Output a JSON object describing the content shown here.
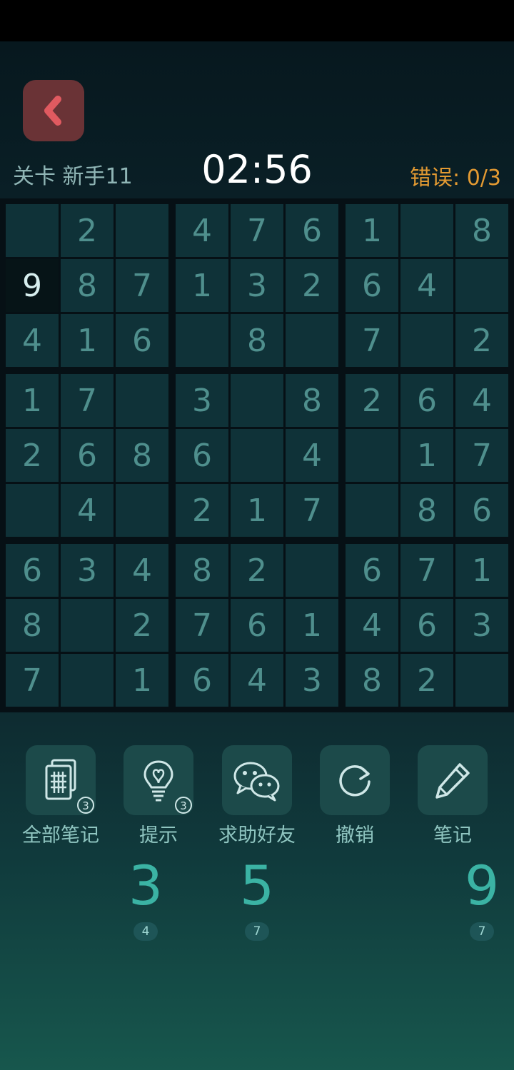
{
  "header": {
    "level": "关卡 新手11",
    "timer": "02:56",
    "errors": "错误: 0/3"
  },
  "board": {
    "selected": [
      1,
      0
    ],
    "grid": [
      [
        "",
        "2",
        "",
        "4",
        "7",
        "6",
        "1",
        "",
        "8"
      ],
      [
        "9",
        "8",
        "7",
        "1",
        "3",
        "2",
        "6",
        "4",
        ""
      ],
      [
        "4",
        "1",
        "6",
        "",
        "8",
        "",
        "7",
        "",
        "2"
      ],
      [
        "1",
        "7",
        "",
        "3",
        "",
        "8",
        "2",
        "6",
        "4"
      ],
      [
        "2",
        "6",
        "8",
        "6",
        "",
        "4",
        "",
        "1",
        "7"
      ],
      [
        "",
        "4",
        "",
        "2",
        "1",
        "7",
        "",
        "8",
        "6"
      ],
      [
        "6",
        "3",
        "4",
        "8",
        "2",
        "",
        "6",
        "7",
        "1"
      ],
      [
        "8",
        "",
        "2",
        "7",
        "6",
        "1",
        "4",
        "6",
        "3"
      ],
      [
        "7",
        "",
        "1",
        "6",
        "4",
        "3",
        "8",
        "2",
        ""
      ]
    ]
  },
  "tools": [
    {
      "label": "全部笔记",
      "icon": "all-notes-icon",
      "badge": "3"
    },
    {
      "label": "提示",
      "icon": "lightbulb-icon",
      "badge": "3"
    },
    {
      "label": "求助好友",
      "icon": "wechat-icon",
      "badge": ""
    },
    {
      "label": "撤销",
      "icon": "undo-icon",
      "badge": ""
    },
    {
      "label": "笔记",
      "icon": "pencil-icon",
      "badge": ""
    }
  ],
  "numpad": [
    {
      "digit": "3",
      "remaining": "4"
    },
    {
      "digit": "5",
      "remaining": "7"
    },
    {
      "digit": "9",
      "remaining": "7"
    }
  ],
  "colors": {
    "given_digit": "#4f8f8d",
    "selected_digit": "#d6eeee",
    "errors": "#e39a32",
    "numpad_digit": "#3bb3a4",
    "back_button": "#6a3336"
  }
}
